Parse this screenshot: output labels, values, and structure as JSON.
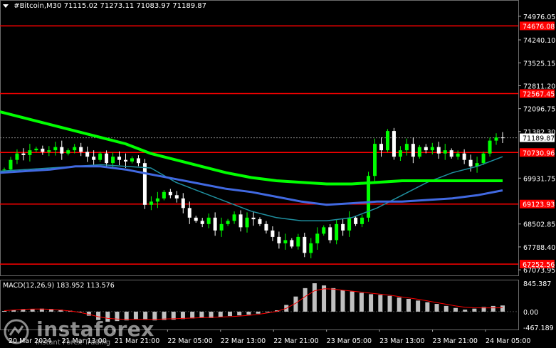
{
  "header": {
    "symbol": "#Bitcoin,M30",
    "ohlc": "71115.02 71273.11 71083.97 71189.87"
  },
  "macd": {
    "label": "MACD(12,26,9) 183.952 113.576",
    "ticks": [
      "845.387",
      "0.00",
      "-467.189"
    ]
  },
  "logo": {
    "name": "instaforex",
    "tagline": "Instant Forex Trading"
  },
  "colors": {
    "background": "#000000",
    "bull_candle": "#00ff00",
    "bear_candle": "#ffffff",
    "level_line": "#ff0000",
    "ma_fast": "#1f8f9f",
    "ma_mid": "#4169e1",
    "ma_slow": "#00ff00",
    "macd_hist": "#c0c0c0",
    "macd_signal": "#ff0000"
  },
  "chart_data": {
    "type": "candlestick",
    "title": "#Bitcoin,M30",
    "y_ticks": [
      "74976.05",
      "74240.10",
      "73525.15",
      "72811.20",
      "72096.75",
      "71382.30",
      "69931.75",
      "68502.85",
      "67788.40",
      "67073.95"
    ],
    "ylim": [
      66900,
      75350
    ],
    "x_ticks": [
      "20 Mar 2024",
      "21 Mar 13:00",
      "21 Mar 21:00",
      "22 Mar 05:00",
      "22 Mar 13:00",
      "22 Mar 21:00",
      "23 Mar 05:00",
      "23 Mar 13:00",
      "23 Mar 21:00",
      "24 Mar 05:00"
    ],
    "current_price": "71189.87",
    "levels": [
      {
        "value": 74676.08,
        "label": "74676.08"
      },
      {
        "value": 72567.45,
        "label": "72567.45"
      },
      {
        "value": 70730.96,
        "label": "70730.96"
      },
      {
        "value": 69123.93,
        "label": "69123.93"
      },
      {
        "value": 67252.56,
        "label": "67252.56"
      }
    ],
    "close_path": [
      70200,
      70500,
      70700,
      70650,
      70800,
      70850,
      70750,
      70800,
      70900,
      70700,
      70800,
      70900,
      70750,
      70600,
      70500,
      70700,
      70400,
      70600,
      70500,
      70450,
      70550,
      70400,
      69100,
      69200,
      69300,
      69500,
      69400,
      69300,
      69000,
      68700,
      68600,
      68500,
      68700,
      68300,
      68500,
      68600,
      68800,
      68400,
      68700,
      68650,
      68500,
      68300,
      68100,
      67900,
      68000,
      67800,
      68100,
      67600,
      67900,
      68200,
      68400,
      68000,
      68500,
      68300,
      68700,
      68500,
      68700,
      70000,
      71000,
      70800,
      71400,
      70600,
      70800,
      71000,
      70600,
      70900,
      70800,
      70900,
      70700,
      70800,
      70600,
      70700,
      70500,
      70300,
      70400,
      70700,
      71100,
      71200,
      71190
    ],
    "ma_fast": [
      70150,
      70200,
      70250,
      70300,
      70350,
      70300,
      70250,
      69800,
      69500,
      69200,
      68900,
      68700,
      68600,
      68600,
      68700,
      69000,
      69400,
      69800,
      70100,
      70300,
      70600
    ],
    "ma_mid": [
      70100,
      70150,
      70200,
      70300,
      70300,
      70200,
      70050,
      69900,
      69750,
      69600,
      69500,
      69350,
      69200,
      69100,
      69150,
      69200,
      69200,
      69250,
      69300,
      69400,
      69550
    ],
    "ma_slow": [
      72000,
      71800,
      71600,
      71400,
      71200,
      71000,
      70700,
      70500,
      70300,
      70100,
      69950,
      69850,
      69800,
      69750,
      69750,
      69800,
      69850,
      69850,
      69850,
      69850,
      69850
    ],
    "macd_hist": [
      20,
      40,
      60,
      80,
      90,
      80,
      60,
      30,
      -10,
      -120,
      -250,
      -300,
      -280,
      -260,
      -230,
      -240,
      -260,
      -250,
      -240,
      -220,
      -200,
      -180,
      -190,
      -160,
      -130,
      -110,
      -90,
      -60,
      -20,
      40,
      200,
      450,
      700,
      845,
      780,
      700,
      640,
      600,
      560,
      520,
      500,
      470,
      420,
      380,
      330,
      280,
      230,
      170,
      110,
      60,
      90,
      140,
      170,
      184
    ],
    "macd_signal": [
      30,
      50,
      70,
      80,
      80,
      70,
      50,
      20,
      -20,
      -80,
      -150,
      -200,
      -220,
      -230,
      -230,
      -230,
      -230,
      -220,
      -210,
      -200,
      -190,
      -180,
      -170,
      -160,
      -150,
      -130,
      -110,
      -80,
      -40,
      10,
      100,
      250,
      450,
      620,
      680,
      670,
      640,
      610,
      580,
      550,
      520,
      490,
      450,
      410,
      370,
      320,
      270,
      220,
      170,
      130,
      115,
      113,
      113,
      114
    ]
  }
}
